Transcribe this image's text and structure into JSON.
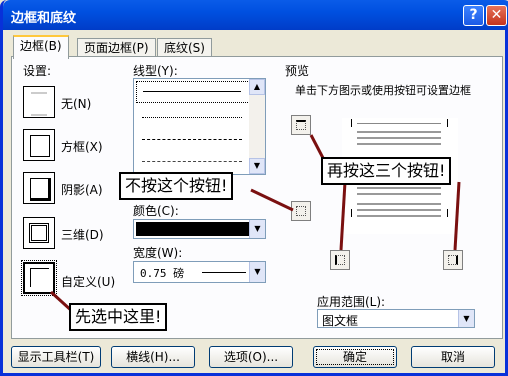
{
  "window": {
    "title": "边框和底纹",
    "help_btn": "?",
    "close_btn": "✕"
  },
  "tabs": [
    {
      "label": "边框(B)",
      "active": true
    },
    {
      "label": "页面边框(P)"
    },
    {
      "label": "底纹(S)"
    }
  ],
  "setting": {
    "label": "设置:",
    "items": [
      {
        "label": "无(N)"
      },
      {
        "label": "方框(X)"
      },
      {
        "label": "阴影(A)"
      },
      {
        "label": "三维(D)"
      },
      {
        "label": "自定义(U)"
      }
    ]
  },
  "style": {
    "label": "线型(Y):"
  },
  "color": {
    "label": "颜色(C):",
    "value": "#000000"
  },
  "width": {
    "label": "宽度(W):",
    "value": "0.75 磅"
  },
  "preview": {
    "label": "预览",
    "hint": "单击下方图示或使用按钮可设置边框"
  },
  "apply_to": {
    "label": "应用范围(L):",
    "value": "图文框"
  },
  "callouts": {
    "first_select": "先选中这里!",
    "dont_press": "不按这个按钮!",
    "press_these": "再按这三个按钮!"
  },
  "buttons": {
    "toolbar": "显示工具栏(T)",
    "hline": "横线(H)...",
    "options": "选项(O)...",
    "ok": "确定",
    "cancel": "取消"
  },
  "annotation_color": "#7a1010"
}
